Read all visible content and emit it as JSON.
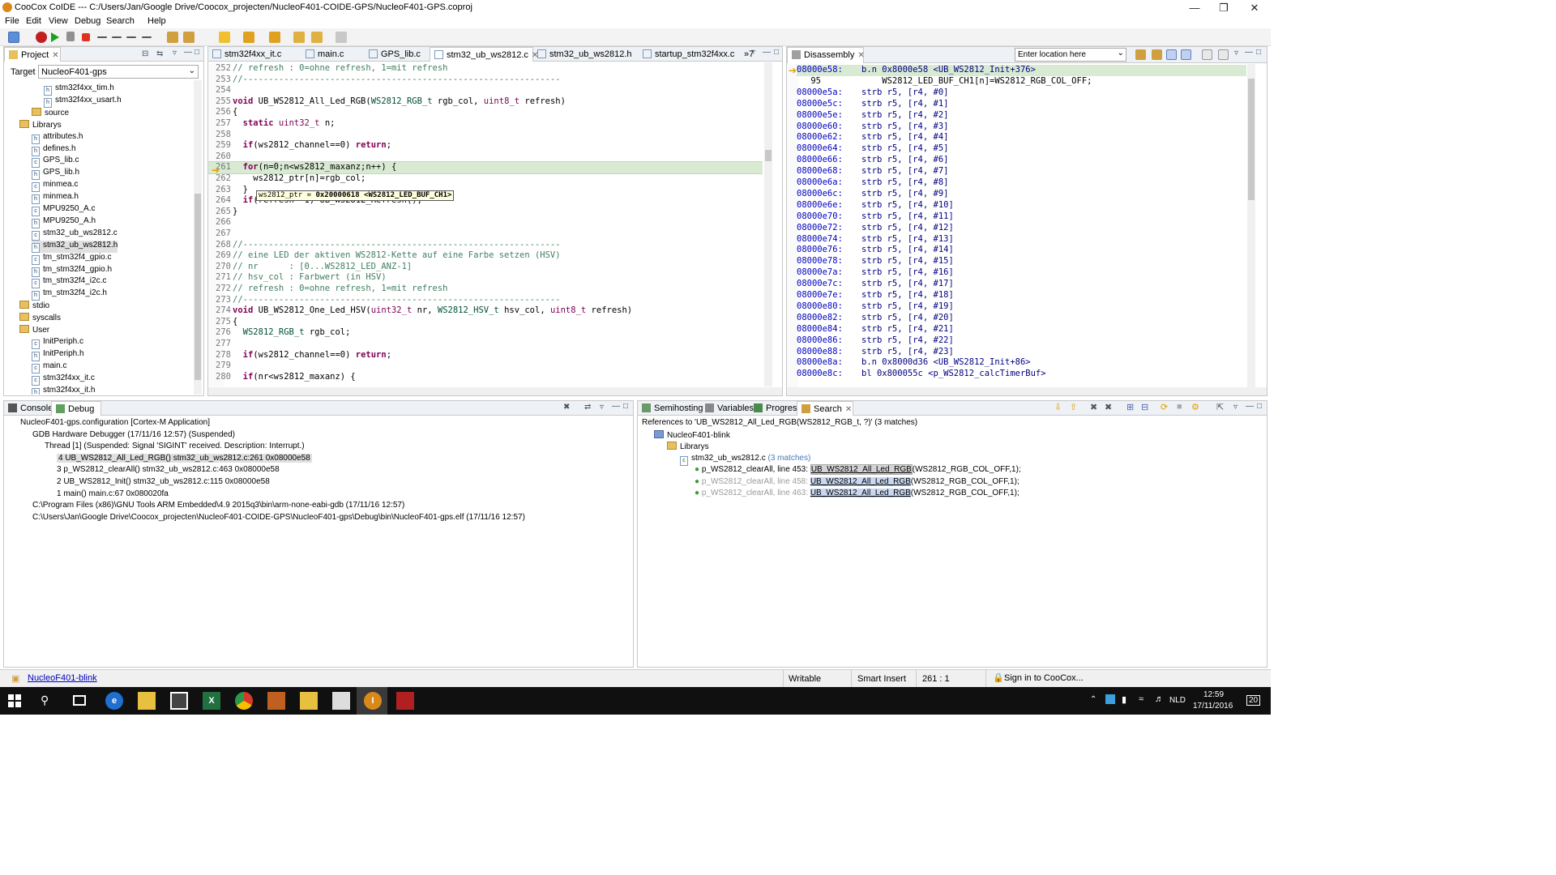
{
  "window": {
    "title": "CooCox CoIDE --- C:/Users/Jan/Google Drive/Coocox_projecten/NucleoF401-COIDE-GPS/NucleoF401-GPS.coproj"
  },
  "menu": [
    "File",
    "Edit",
    "View",
    "Debug",
    "Search",
    "Help"
  ],
  "project": {
    "tab_label": "Project",
    "target_label": "Target",
    "target_value": "NucleoF401-gps",
    "tree": [
      {
        "label": "stm32f4xx_tim.h",
        "type": "file",
        "indent": 3
      },
      {
        "label": "stm32f4xx_usart.h",
        "type": "file",
        "indent": 3
      },
      {
        "label": "source",
        "type": "folder",
        "indent": 2
      },
      {
        "label": "Librarys",
        "type": "folder",
        "indent": 1
      },
      {
        "label": "attributes.h",
        "type": "file",
        "indent": 2
      },
      {
        "label": "defines.h",
        "type": "file",
        "indent": 2
      },
      {
        "label": "GPS_lib.c",
        "type": "file",
        "indent": 2
      },
      {
        "label": "GPS_lib.h",
        "type": "file",
        "indent": 2
      },
      {
        "label": "minmea.c",
        "type": "file",
        "indent": 2
      },
      {
        "label": "minmea.h",
        "type": "file",
        "indent": 2
      },
      {
        "label": "MPU9250_A.c",
        "type": "file",
        "indent": 2
      },
      {
        "label": "MPU9250_A.h",
        "type": "file",
        "indent": 2
      },
      {
        "label": "stm32_ub_ws2812.c",
        "type": "file",
        "indent": 2
      },
      {
        "label": "stm32_ub_ws2812.h",
        "type": "file",
        "indent": 2,
        "selected": true
      },
      {
        "label": "tm_stm32f4_gpio.c",
        "type": "file",
        "indent": 2
      },
      {
        "label": "tm_stm32f4_gpio.h",
        "type": "file",
        "indent": 2
      },
      {
        "label": "tm_stm32f4_i2c.c",
        "type": "file",
        "indent": 2
      },
      {
        "label": "tm_stm32f4_i2c.h",
        "type": "file",
        "indent": 2
      },
      {
        "label": "stdio",
        "type": "folder",
        "indent": 1
      },
      {
        "label": "syscalls",
        "type": "folder",
        "indent": 1
      },
      {
        "label": "User",
        "type": "folder",
        "indent": 1
      },
      {
        "label": "InitPeriph.c",
        "type": "file",
        "indent": 2
      },
      {
        "label": "InitPeriph.h",
        "type": "file",
        "indent": 2
      },
      {
        "label": "main.c",
        "type": "file",
        "indent": 2
      },
      {
        "label": "stm32f4xx_it.c",
        "type": "file",
        "indent": 2
      },
      {
        "label": "stm32f4xx_it.h",
        "type": "file",
        "indent": 2
      }
    ]
  },
  "editor": {
    "tabs": [
      {
        "label": "stm32f4xx_it.c"
      },
      {
        "label": "main.c"
      },
      {
        "label": "GPS_lib.c"
      },
      {
        "label": "stm32_ub_ws2812.c",
        "active": true
      },
      {
        "label": "stm32_ub_ws2812.h"
      },
      {
        "label": "startup_stm32f4xx.c"
      },
      {
        "label": "»7"
      }
    ],
    "lines": [
      {
        "n": "252",
        "t": "// refresh : 0=ohne refresh, 1=mit refresh",
        "c": "cmt"
      },
      {
        "n": "253",
        "t": "//--------------------------------------------------------------",
        "c": "cmt"
      },
      {
        "n": "254",
        "t": "",
        "c": ""
      },
      {
        "n": "255",
        "t": "void UB_WS2812_All_Led_RGB(WS2812_RGB_t rgb_col, uint8_t refresh)",
        "c": "fn"
      },
      {
        "n": "256",
        "t": "{",
        "c": ""
      },
      {
        "n": "257",
        "t": "  static uint32_t n;",
        "c": "st"
      },
      {
        "n": "258",
        "t": "",
        "c": ""
      },
      {
        "n": "259",
        "t": "  if(ws2812_channel==0) return;",
        "c": "if"
      },
      {
        "n": "260",
        "t": "",
        "c": ""
      },
      {
        "n": "261",
        "t": "  for(n=0;n<ws2812_maxanz;n++) {",
        "c": "for"
      },
      {
        "n": "262",
        "t": "    ws2812_ptr[n]=rgb_col;",
        "c": ""
      },
      {
        "n": "263",
        "t": "  }",
        "c": ""
      },
      {
        "n": "264",
        "t": "  if(refresh==1) UB_WS2812_Refresh();",
        "c": "if"
      },
      {
        "n": "265",
        "t": "}",
        "c": ""
      },
      {
        "n": "266",
        "t": "",
        "c": ""
      },
      {
        "n": "267",
        "t": "",
        "c": ""
      },
      {
        "n": "268",
        "t": "//--------------------------------------------------------------",
        "c": "cmt"
      },
      {
        "n": "269",
        "t": "// eine LED der aktiven WS2812-Kette auf eine Farbe setzen (HSV)",
        "c": "cmt"
      },
      {
        "n": "270",
        "t": "// nr      : [0...WS2812_LED_ANZ-1]",
        "c": "cmt"
      },
      {
        "n": "271",
        "t": "// hsv_col : Farbwert (in HSV)",
        "c": "cmt"
      },
      {
        "n": "272",
        "t": "// refresh : 0=ohne refresh, 1=mit refresh",
        "c": "cmt"
      },
      {
        "n": "273",
        "t": "//--------------------------------------------------------------",
        "c": "cmt"
      },
      {
        "n": "274",
        "t": "void UB_WS2812_One_Led_HSV(uint32_t nr, WS2812_HSV_t hsv_col, uint8_t refresh)",
        "c": "fn"
      },
      {
        "n": "275",
        "t": "{",
        "c": ""
      },
      {
        "n": "276",
        "t": "  WS2812_RGB_t rgb_col;",
        "c": ""
      },
      {
        "n": "277",
        "t": "",
        "c": ""
      },
      {
        "n": "278",
        "t": "  if(ws2812_channel==0) return;",
        "c": "if"
      },
      {
        "n": "279",
        "t": "",
        "c": ""
      },
      {
        "n": "280",
        "t": "  if(nr<ws2812_maxanz) {",
        "c": "if"
      }
    ],
    "tooltip_prefix": "ws2812_ptr = ",
    "tooltip_value": "0x20000618 <WS2812_LED_BUF_CH1>"
  },
  "disassembly": {
    "tab_label": "Disassembly",
    "location_placeholder": "Enter location here",
    "lines": [
      {
        "a": "08000e58:",
        "i": "b.n 0x8000e58 <UB_WS2812_Init+376>",
        "current": true
      },
      {
        "a": "95",
        "i": "    WS2812_LED_BUF_CH1[n]=WS2812_RGB_COL_OFF;",
        "src": true
      },
      {
        "a": "08000e5a:",
        "i": "strb r5, [r4, #0]"
      },
      {
        "a": "08000e5c:",
        "i": "strb r5, [r4, #1]"
      },
      {
        "a": "08000e5e:",
        "i": "strb r5, [r4, #2]"
      },
      {
        "a": "08000e60:",
        "i": "strb r5, [r4, #3]"
      },
      {
        "a": "08000e62:",
        "i": "strb r5, [r4, #4]"
      },
      {
        "a": "08000e64:",
        "i": "strb r5, [r4, #5]"
      },
      {
        "a": "08000e66:",
        "i": "strb r5, [r4, #6]"
      },
      {
        "a": "08000e68:",
        "i": "strb r5, [r4, #7]"
      },
      {
        "a": "08000e6a:",
        "i": "strb r5, [r4, #8]"
      },
      {
        "a": "08000e6c:",
        "i": "strb r5, [r4, #9]"
      },
      {
        "a": "08000e6e:",
        "i": "strb r5, [r4, #10]"
      },
      {
        "a": "08000e70:",
        "i": "strb r5, [r4, #11]"
      },
      {
        "a": "08000e72:",
        "i": "strb r5, [r4, #12]"
      },
      {
        "a": "08000e74:",
        "i": "strb r5, [r4, #13]"
      },
      {
        "a": "08000e76:",
        "i": "strb r5, [r4, #14]"
      },
      {
        "a": "08000e78:",
        "i": "strb r5, [r4, #15]"
      },
      {
        "a": "08000e7a:",
        "i": "strb r5, [r4, #16]"
      },
      {
        "a": "08000e7c:",
        "i": "strb r5, [r4, #17]"
      },
      {
        "a": "08000e7e:",
        "i": "strb r5, [r4, #18]"
      },
      {
        "a": "08000e80:",
        "i": "strb r5, [r4, #19]"
      },
      {
        "a": "08000e82:",
        "i": "strb r5, [r4, #20]"
      },
      {
        "a": "08000e84:",
        "i": "strb r5, [r4, #21]"
      },
      {
        "a": "08000e86:",
        "i": "strb r5, [r4, #22]"
      },
      {
        "a": "08000e88:",
        "i": "strb r5, [r4, #23]"
      },
      {
        "a": "08000e8a:",
        "i": "b.n 0x8000d36 <UB_WS2812_Init+86>"
      },
      {
        "a": "08000e8c:",
        "i": "bl 0x800055c <p_WS2812_calcTimerBuf>"
      }
    ]
  },
  "debug": {
    "tabs": [
      {
        "label": "Console"
      },
      {
        "label": "Debug",
        "active": true
      }
    ],
    "rows": [
      {
        "t": "NucleoF401-gps.configuration [Cortex-M Application]",
        "indent": 0
      },
      {
        "t": "GDB Hardware Debugger (17/11/16 12:57) (Suspended)",
        "indent": 1
      },
      {
        "t": "Thread [1] (Suspended: Signal 'SIGINT' received. Description: Interrupt.)",
        "indent": 2
      },
      {
        "t": "4 UB_WS2812_All_Led_RGB() stm32_ub_ws2812.c:261 0x08000e58",
        "indent": 3,
        "selected": true
      },
      {
        "t": "3 p_WS2812_clearAll() stm32_ub_ws2812.c:463 0x08000e58",
        "indent": 3
      },
      {
        "t": "2 UB_WS2812_Init() stm32_ub_ws2812.c:115 0x08000e58",
        "indent": 3
      },
      {
        "t": "1 main() main.c:67 0x080020fa",
        "indent": 3
      },
      {
        "t": "C:\\Program Files (x86)\\GNU Tools ARM Embedded\\4.9 2015q3\\bin\\arm-none-eabi-gdb (17/11/16 12:57)",
        "indent": 1
      },
      {
        "t": "C:\\Users\\Jan\\Google Drive\\Coocox_projecten\\NucleoF401-COIDE-GPS\\NucleoF401-gps\\Debug\\bin\\NucleoF401-gps.elf (17/11/16 12:57)",
        "indent": 1
      }
    ]
  },
  "search": {
    "tabs": [
      {
        "label": "Semihosting"
      },
      {
        "label": "Variables"
      },
      {
        "label": "Progress"
      },
      {
        "label": "Search",
        "active": true
      }
    ],
    "header": "References to 'UB_WS2812_All_Led_RGB(WS2812_RGB_t, ?)' (3 matches)",
    "project": "NucleoF401-blink",
    "folder": "Librarys",
    "file": "stm32_ub_ws2812.c",
    "file_matches": "(3 matches)",
    "results": [
      {
        "pre": "p_WS2812_clearAll, line 453: ",
        "match": "UB_WS2812_All_Led_RGB",
        "post": "(WS2812_RGB_COL_OFF,1);",
        "selected": true
      },
      {
        "pre": "p_WS2812_clearAll, line 458: ",
        "match": "UB_WS2812_All_Led_RGB",
        "post": "(WS2812_RGB_COL_OFF,1);"
      },
      {
        "pre": "p_WS2812_clearAll, line 463: ",
        "match": "UB_WS2812_All_Led_RGB",
        "post": "(WS2812_RGB_COL_OFF,1);"
      }
    ]
  },
  "status": {
    "project_link": "NucleoF401-blink",
    "mode": "Writable",
    "insert": "Smart Insert",
    "position": "261 : 1",
    "signin": "Sign in to CooCox..."
  },
  "taskbar": {
    "time": "12:59",
    "date": "17/11/2016",
    "lang": "NLD",
    "notif": "20"
  }
}
